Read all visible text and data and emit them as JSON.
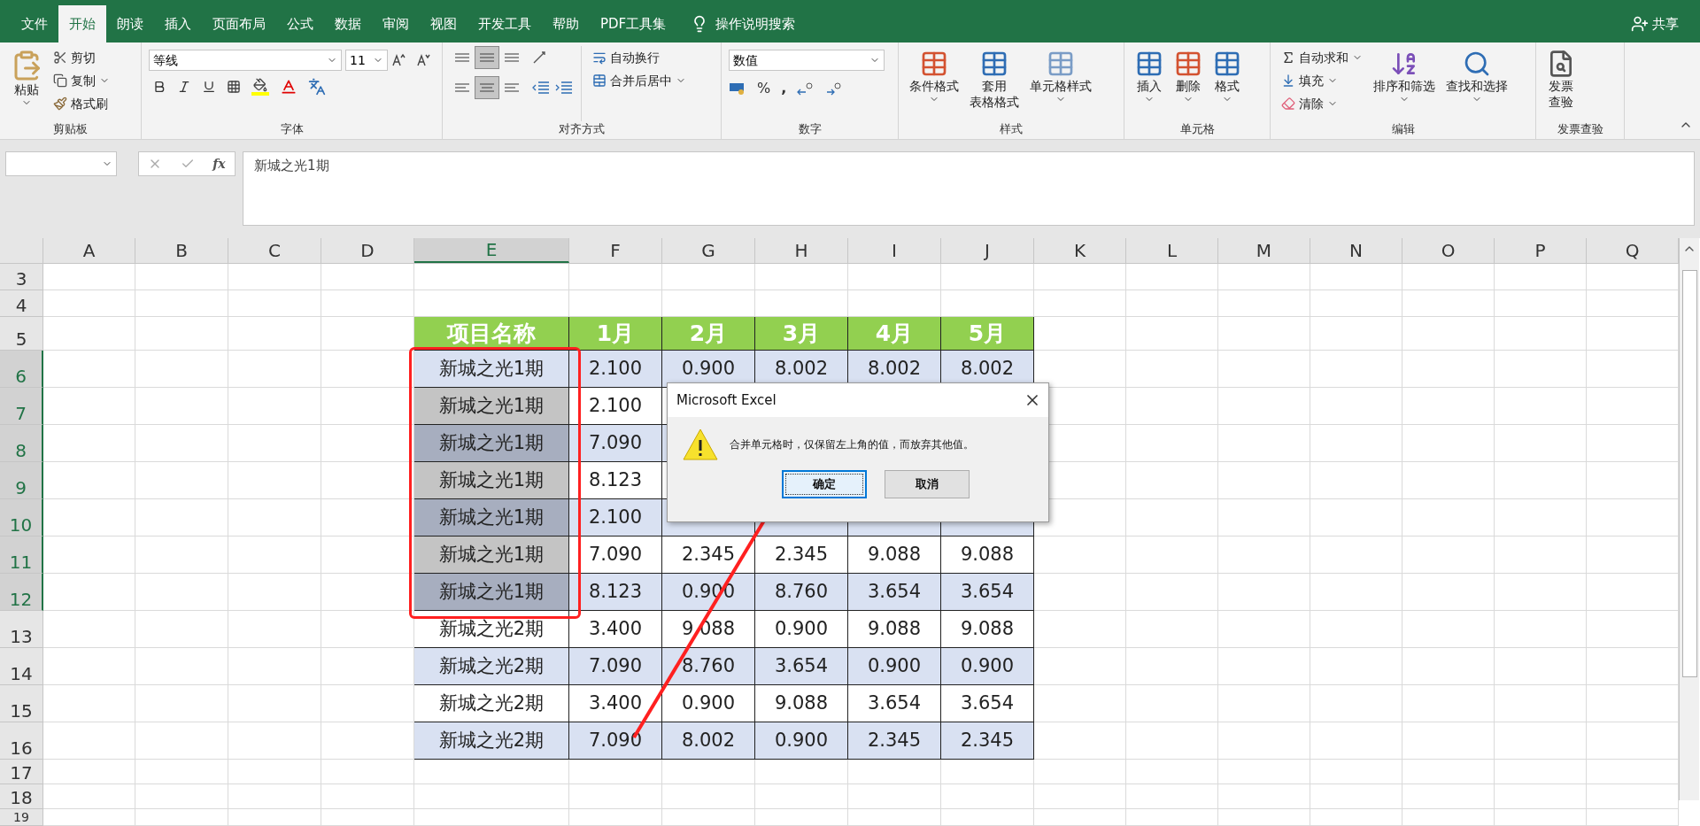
{
  "menu_tabs": [
    {
      "label": "文件",
      "selected": false
    },
    {
      "label": "开始",
      "selected": true
    },
    {
      "label": "朗读",
      "selected": false
    },
    {
      "label": "插入",
      "selected": false
    },
    {
      "label": "页面布局",
      "selected": false
    },
    {
      "label": "公式",
      "selected": false
    },
    {
      "label": "数据",
      "selected": false
    },
    {
      "label": "审阅",
      "selected": false
    },
    {
      "label": "视图",
      "selected": false
    },
    {
      "label": "开发工具",
      "selected": false
    },
    {
      "label": "帮助",
      "selected": false
    },
    {
      "label": "PDF工具集",
      "selected": false
    }
  ],
  "tell_me": "操作说明搜索",
  "share": "共享",
  "clipboard": {
    "label": "剪贴板",
    "paste": "粘贴",
    "cut": "剪切",
    "copy": "复制",
    "format_painter": "格式刷"
  },
  "font": {
    "label": "字体",
    "name": "等线",
    "size": "11"
  },
  "alignment": {
    "label": "对齐方式",
    "vertical": [
      {
        "selected": false
      },
      {
        "selected": true
      },
      {
        "selected": false
      }
    ],
    "horizontal": [
      {
        "selected": false
      },
      {
        "selected": true
      },
      {
        "selected": false
      }
    ],
    "wrap": "自动换行",
    "merge": "合并后居中"
  },
  "number": {
    "label": "数字",
    "format": "数值",
    "percent": "%",
    "comma": ","
  },
  "styles": {
    "label": "样式",
    "conditional": "条件格式",
    "table_format": [
      "套用",
      "表格格式"
    ],
    "cell_styles": "单元格样式"
  },
  "cells": {
    "label": "单元格",
    "insert": "插入",
    "delete": "删除",
    "format": "格式"
  },
  "editing": {
    "label": "编辑",
    "autosum": "自动求和",
    "fill": "填充",
    "clear": "清除",
    "sort": "排序和筛选",
    "find": "查找和选择"
  },
  "invoice": {
    "label": "发票查验",
    "check": [
      "发票",
      "查验"
    ]
  },
  "formula_bar": {
    "fx": "fx",
    "content": "新城之光1期"
  },
  "columns": [
    {
      "label": "A",
      "selected": false
    },
    {
      "label": "B",
      "selected": false
    },
    {
      "label": "C",
      "selected": false
    },
    {
      "label": "D",
      "selected": false
    },
    {
      "label": "E",
      "selected": true
    },
    {
      "label": "F",
      "selected": false
    },
    {
      "label": "G",
      "selected": false
    },
    {
      "label": "H",
      "selected": false
    },
    {
      "label": "I",
      "selected": false
    },
    {
      "label": "J",
      "selected": false
    },
    {
      "label": "K",
      "selected": false
    },
    {
      "label": "L",
      "selected": false
    },
    {
      "label": "M",
      "selected": false
    },
    {
      "label": "N",
      "selected": false
    },
    {
      "label": "O",
      "selected": false
    },
    {
      "label": "P",
      "selected": false
    },
    {
      "label": "Q",
      "selected": false
    }
  ],
  "row_headers": [
    {
      "label": "3",
      "selected": false
    },
    {
      "label": "4",
      "selected": false
    },
    {
      "label": "5",
      "selected": false
    },
    {
      "label": "6",
      "selected": true
    },
    {
      "label": "7",
      "selected": true
    },
    {
      "label": "8",
      "selected": true
    },
    {
      "label": "9",
      "selected": true
    },
    {
      "label": "10",
      "selected": true
    },
    {
      "label": "11",
      "selected": true
    },
    {
      "label": "12",
      "selected": true
    },
    {
      "label": "13",
      "selected": false
    },
    {
      "label": "14",
      "selected": false
    },
    {
      "label": "15",
      "selected": false
    },
    {
      "label": "16",
      "selected": false
    },
    {
      "label": "17",
      "selected": false
    },
    {
      "label": "18",
      "selected": false
    },
    {
      "label": "19",
      "selected": false
    }
  ],
  "table": {
    "header": [
      "项目名称",
      "1月",
      "2月",
      "3月",
      "4月",
      "5月"
    ],
    "rows": [
      {
        "banded": true,
        "selected": false,
        "cells": [
          "新城之光1期",
          "2.100",
          "0.900",
          "8.002",
          "8.002",
          "8.002"
        ]
      },
      {
        "banded": false,
        "selected": true,
        "cells": [
          "新城之光1期",
          "2.100",
          null,
          null,
          null,
          null
        ]
      },
      {
        "banded": true,
        "selected": true,
        "cells": [
          "新城之光1期",
          "7.090",
          null,
          null,
          null,
          null
        ]
      },
      {
        "banded": false,
        "selected": true,
        "cells": [
          "新城之光1期",
          "8.123",
          null,
          null,
          null,
          null
        ]
      },
      {
        "banded": true,
        "selected": true,
        "cells": [
          "新城之光1期",
          "2.100",
          null,
          null,
          null,
          null
        ]
      },
      {
        "banded": false,
        "selected": true,
        "cells": [
          "新城之光1期",
          "7.090",
          "2.345",
          "2.345",
          "9.088",
          "9.088"
        ]
      },
      {
        "banded": true,
        "selected": true,
        "cells": [
          "新城之光1期",
          "8.123",
          "0.900",
          "8.760",
          "3.654",
          "3.654"
        ]
      },
      {
        "banded": false,
        "selected": false,
        "cells": [
          "新城之光2期",
          "3.400",
          "9.088",
          "0.900",
          "9.088",
          "9.088"
        ]
      },
      {
        "banded": true,
        "selected": false,
        "cells": [
          "新城之光2期",
          "7.090",
          "8.760",
          "3.654",
          "0.900",
          "0.900"
        ]
      },
      {
        "banded": false,
        "selected": false,
        "cells": [
          "新城之光2期",
          "3.400",
          "0.900",
          "9.088",
          "3.654",
          "3.654"
        ]
      },
      {
        "banded": true,
        "selected": false,
        "cells": [
          "新城之光2期",
          "7.090",
          "8.002",
          "0.900",
          "2.345",
          "2.345"
        ]
      }
    ]
  },
  "dialog": {
    "title": "Microsoft Excel",
    "message": "合并单元格时，仅保留左上角的值，而放弃其他值。",
    "buttons": [
      {
        "label": "确定",
        "selected": true
      },
      {
        "label": "取消",
        "selected": false
      }
    ]
  }
}
